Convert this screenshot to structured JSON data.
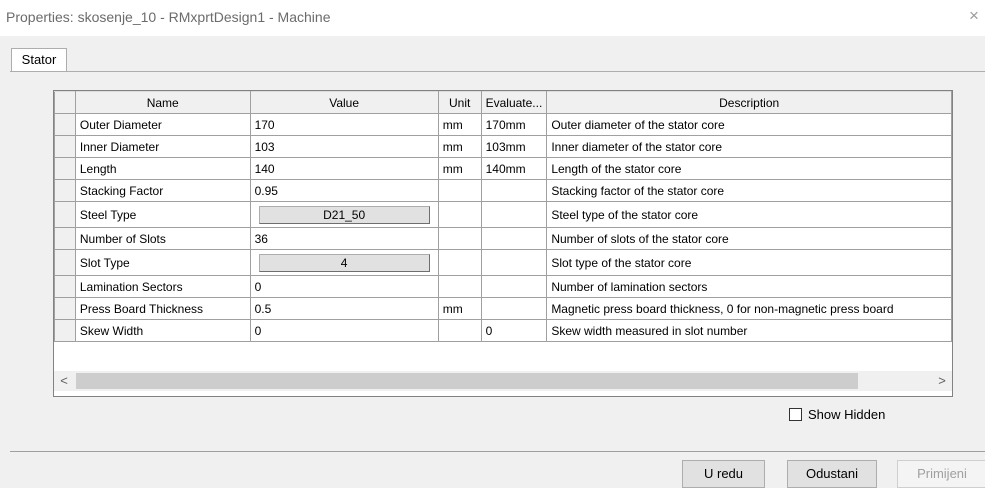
{
  "window": {
    "title": "Properties: skosenje_10 - RMxprtDesign1 - Machine",
    "close_glyph": "×"
  },
  "tabs": [
    {
      "label": "Stator",
      "active": true
    }
  ],
  "grid": {
    "columns": [
      "Name",
      "Value",
      "Unit",
      "Evaluate...",
      "Description"
    ],
    "rows": [
      {
        "name": "Outer Diameter",
        "value": "170",
        "unit": "mm",
        "evaluated": "170mm",
        "description": "Outer diameter of the stator core",
        "value_is_button": false
      },
      {
        "name": "Inner Diameter",
        "value": "103",
        "unit": "mm",
        "evaluated": "103mm",
        "description": "Inner diameter of the stator core",
        "value_is_button": false
      },
      {
        "name": "Length",
        "value": "140",
        "unit": "mm",
        "evaluated": "140mm",
        "description": "Length of the stator core",
        "value_is_button": false
      },
      {
        "name": "Stacking Factor",
        "value": "0.95",
        "unit": "",
        "evaluated": "",
        "description": "Stacking factor of the stator core",
        "value_is_button": false
      },
      {
        "name": "Steel Type",
        "value": "D21_50",
        "unit": "",
        "evaluated": "",
        "description": "Steel type of the stator core",
        "value_is_button": true
      },
      {
        "name": "Number of Slots",
        "value": "36",
        "unit": "",
        "evaluated": "",
        "description": "Number of slots of the stator core",
        "value_is_button": false
      },
      {
        "name": "Slot Type",
        "value": "4",
        "unit": "",
        "evaluated": "",
        "description": "Slot type of the stator core",
        "value_is_button": true
      },
      {
        "name": "Lamination Sectors",
        "value": "0",
        "unit": "",
        "evaluated": "",
        "description": "Number of lamination sectors",
        "value_is_button": false
      },
      {
        "name": "Press Board Thickness",
        "value": "0.5",
        "unit": "mm",
        "evaluated": "",
        "description": "Magnetic press board thickness, 0 for non-magnetic press board",
        "value_is_button": false
      },
      {
        "name": "Skew Width",
        "value": "0",
        "unit": "",
        "evaluated": "0",
        "description": "Skew width measured in slot number",
        "value_is_button": false
      }
    ],
    "scroll_left_glyph": "<",
    "scroll_right_glyph": ">"
  },
  "show_hidden": {
    "label": "Show Hidden",
    "checked": false
  },
  "buttons": {
    "ok": "U redu",
    "cancel": "Odustani",
    "apply": "Primijeni"
  }
}
